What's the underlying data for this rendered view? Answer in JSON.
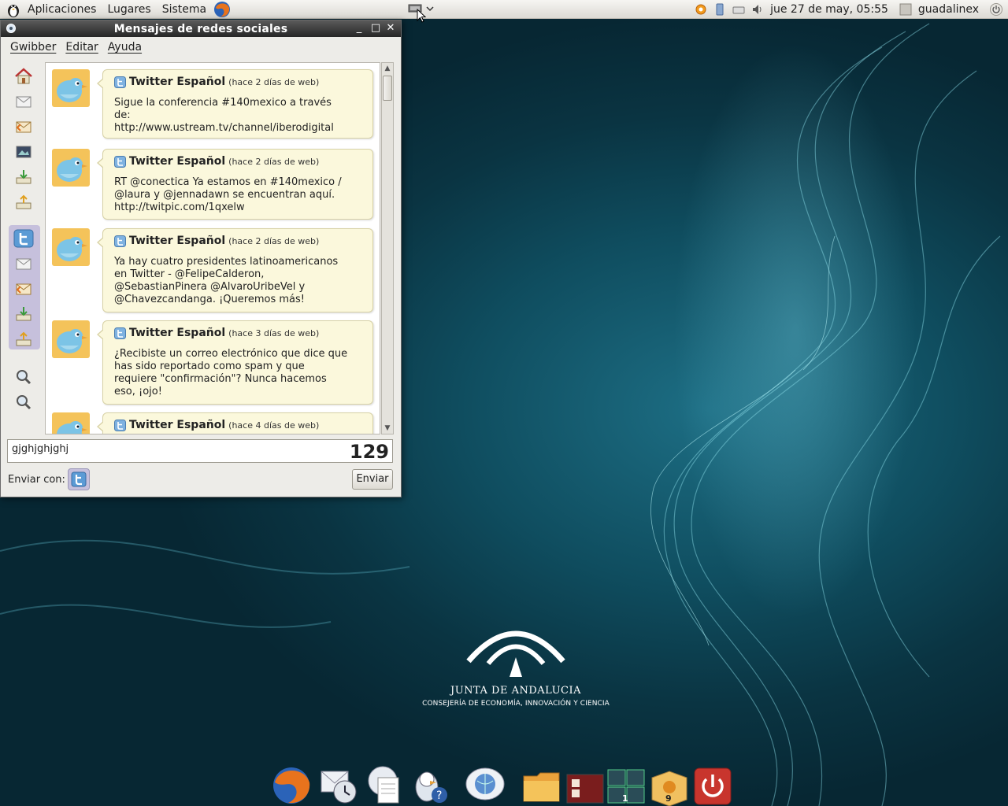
{
  "top_panel": {
    "menus": [
      "Aplicaciones",
      "Lugares",
      "Sistema"
    ],
    "clock": "jue 27 de may, 05:55",
    "user": "guadalinex"
  },
  "window": {
    "title": "Mensajes de redes sociales",
    "menus": [
      "Gwibber",
      "Editar",
      "Ayuda"
    ],
    "messages": [
      {
        "sender": "Twitter Español",
        "meta": "(hace 2 días de web)",
        "text": "Sigue la conferencia #140mexico a través de:\nhttp://www.ustream.tv/channel/iberodigital"
      },
      {
        "sender": "Twitter Español",
        "meta": "(hace 2 días de web)",
        "text": "RT @conectica Ya estamos en #140mexico / @laura y @jennadawn se encuentran aquí. http://twitpic.com/1qxelw"
      },
      {
        "sender": "Twitter Español",
        "meta": "(hace 2 días de web)",
        "text": "Ya hay cuatro presidentes latinoamericanos en Twitter - @FelipeCalderon, @SebastianPinera @AlvaroUribeVel y @Chavezcandanga. ¡Queremos más!"
      },
      {
        "sender": "Twitter Español",
        "meta": "(hace 3 días de web)",
        "text": "¿Recibiste un correo electrónico que dice que has sido reportado como spam y que requiere \"confirmación\"? Nunca hacemos eso, ¡ojo!"
      },
      {
        "sender": "Twitter Español",
        "meta": "(hace 4 días de web)",
        "text": ""
      }
    ],
    "compose_value": "gjghjghjghj",
    "char_count": "129",
    "send_with_label": "Enviar con:",
    "send_button": "Enviar"
  },
  "desktop": {
    "logo_line1": "JUNTA DE ANDALUCIA",
    "logo_line2": "CONSEJERÍA DE ECONOMÍA, INNOVACIÓN Y CIENCIA"
  },
  "dock": {
    "badge_workspace": "1",
    "badge_updates": "9"
  },
  "colors": {
    "bubble": "#fbf8dc",
    "twitter_blue": "#5b9bd5",
    "selection_group": "#c6c0dc",
    "desktop_bg": "#0f4d5f"
  }
}
